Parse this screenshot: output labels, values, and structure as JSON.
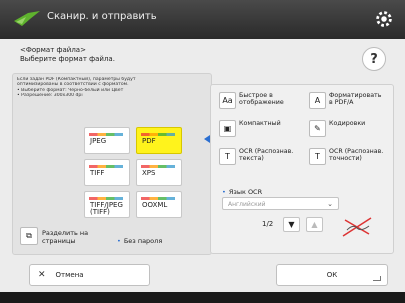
{
  "titlebar": {
    "title": "Сканир. и отправить"
  },
  "header": {
    "line1": "<Формат файла>",
    "line2": "Выберите формат файла."
  },
  "help_label": "?",
  "info_lines": [
    "Если задан PDF (Компактный), параметры будут",
    "оптимизированы в соответствии с форматом.",
    "• Выберите формат: Черно-белый или Цвет",
    "• Разрешение: 300x300 dpi"
  ],
  "formats": [
    {
      "label": "JPEG",
      "selected": false
    },
    {
      "label": "PDF",
      "selected": true
    },
    {
      "label": "TIFF",
      "selected": false
    },
    {
      "label": "XPS",
      "selected": false
    },
    {
      "label": "TIFF/JPEG (TIFF)",
      "selected": false
    },
    {
      "label": "OOXML",
      "selected": false
    }
  ],
  "split_label": "Разделить на страницы",
  "no_password": "Без пароля",
  "options": [
    {
      "label": "Быстрое в отображение",
      "icon": "Aa"
    },
    {
      "label": "Форматировать в PDF/A",
      "icon": "A"
    },
    {
      "label": "Компактный",
      "icon": "▣"
    },
    {
      "label": "Кодировки",
      "icon": "✎"
    },
    {
      "label": "OCR (Распознав. текста)",
      "icon": "T"
    },
    {
      "label": "OCR (Распознав. точности)",
      "icon": "T"
    }
  ],
  "ocr": {
    "label": "Язык OCR",
    "value": "Английский"
  },
  "pager": {
    "text": "1/2"
  },
  "buttons": {
    "cancel": "Отмена",
    "ok": "ОК"
  },
  "colors": {
    "selected": "#fff31c",
    "accent": "#2b6fd1",
    "titlebar": "#333333"
  }
}
